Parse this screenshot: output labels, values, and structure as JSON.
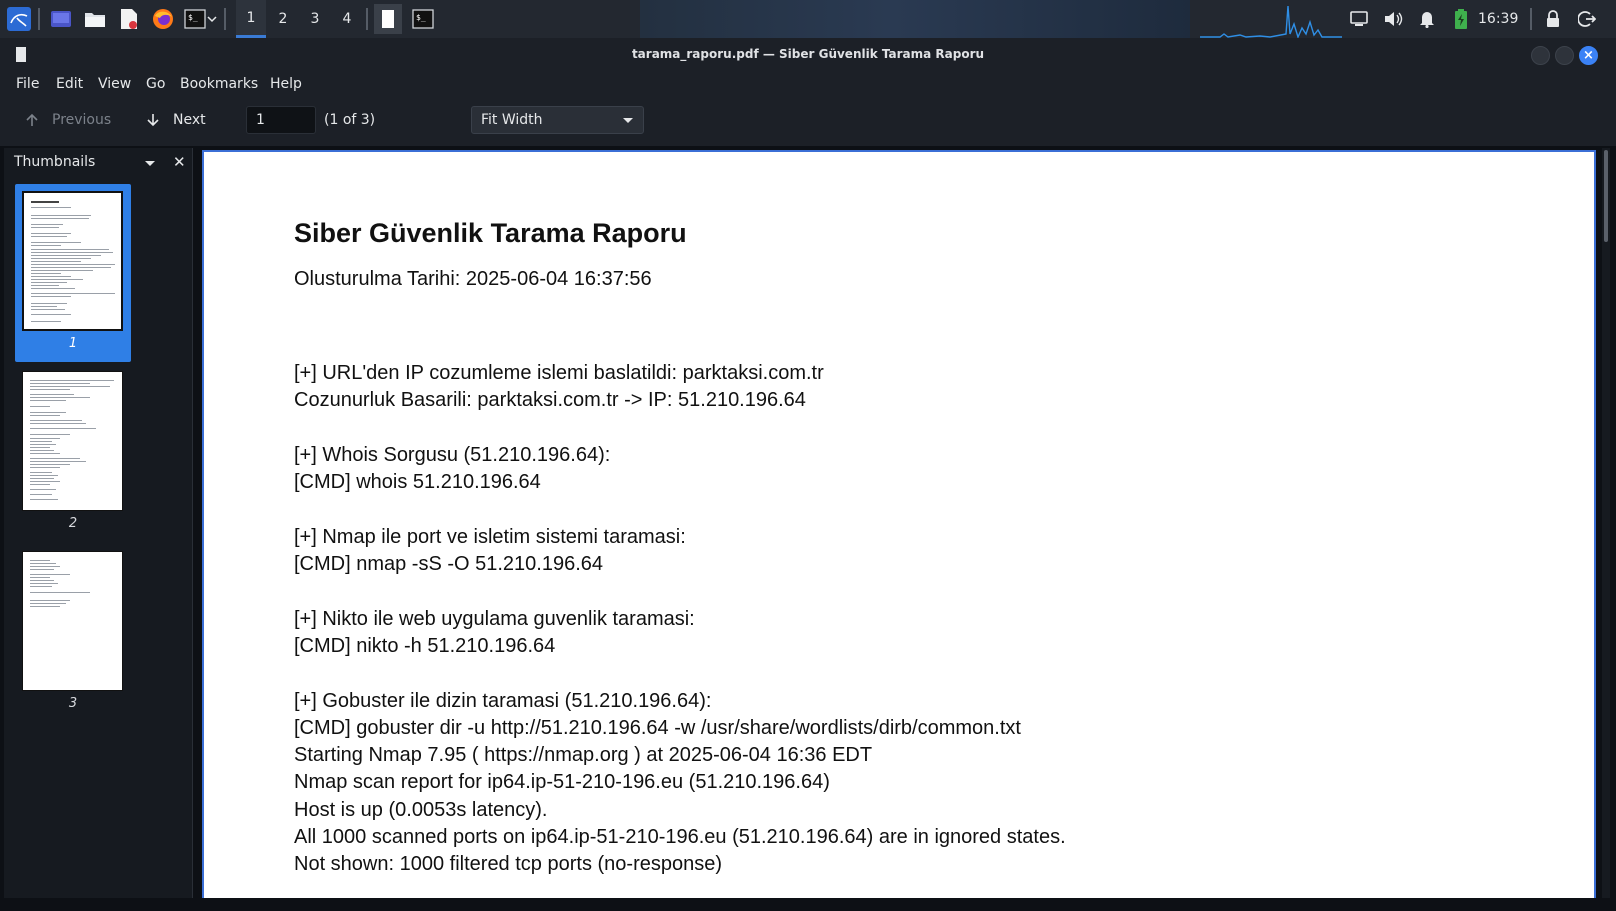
{
  "taskbar": {
    "workspaces": [
      "1",
      "2",
      "3",
      "4"
    ],
    "active_workspace": "1",
    "clock": "16:39",
    "icons": [
      "kali-menu-icon",
      "desktop-icon",
      "file-manager-icon",
      "text-editor-icon",
      "firefox-icon",
      "terminal-icon",
      "dropdown-icon",
      "document-viewer-task-icon",
      "terminal-task-icon",
      "network-graph-icon",
      "display-icon",
      "volume-icon",
      "notification-bell-icon",
      "battery-charging-icon",
      "lock-icon",
      "logout-icon"
    ]
  },
  "window": {
    "title": "tarama_raporu.pdf — Siber Güvenlik Tarama Raporu"
  },
  "menu": [
    "File",
    "Edit",
    "View",
    "Go",
    "Bookmarks",
    "Help"
  ],
  "toolbar": {
    "previous_label": "Previous",
    "next_label": "Next",
    "page_input": "1",
    "page_of": "(1 of 3)",
    "zoom": "Fit Width"
  },
  "sidebar": {
    "title": "Thumbnails",
    "thumbnails": [
      {
        "label": "1",
        "selected": true
      },
      {
        "label": "2",
        "selected": false
      },
      {
        "label": "3",
        "selected": false
      }
    ]
  },
  "document": {
    "title": "Siber Güvenlik Tarama Raporu",
    "date_line": "Olusturulma Tarihi: 2025-06-04 16:37:56",
    "lines": [
      "[+] URL'den IP cozumleme islemi baslatildi: parktaksi.com.tr",
      "Cozunurluk Basarili: parktaksi.com.tr -> IP: 51.210.196.64",
      "",
      "[+] Whois Sorgusu (51.210.196.64):",
      "[CMD] whois 51.210.196.64",
      "",
      "[+] Nmap ile port ve isletim sistemi taramasi:",
      "[CMD] nmap -sS -O 51.210.196.64",
      "",
      "[+] Nikto ile web uygulama guvenlik taramasi:",
      "[CMD] nikto -h 51.210.196.64",
      "",
      "[+] Gobuster ile dizin taramasi (51.210.196.64):",
      "[CMD] gobuster dir -u http://51.210.196.64 -w /usr/share/wordlists/dirb/common.txt",
      "Starting Nmap 7.95 ( https://nmap.org ) at 2025-06-04 16:36 EDT",
      "Nmap scan report for ip64.ip-51-210-196.eu (51.210.196.64)",
      "Host is up (0.0053s latency).",
      "All 1000 scanned ports on ip64.ip-51-210-196.eu (51.210.196.64) are in ignored states.",
      "Not shown: 1000 filtered tcp ports (no-response)"
    ]
  },
  "colors": {
    "accent": "#3b82f6",
    "selection": "#2f7fe6",
    "panel": "#1c2027",
    "taskbar": "#232830"
  }
}
